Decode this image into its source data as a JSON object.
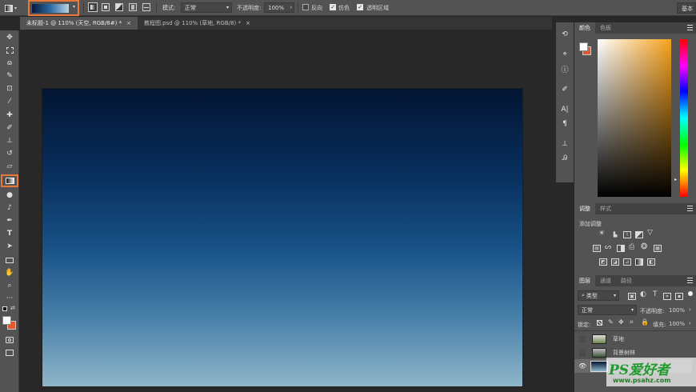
{
  "options_bar": {
    "mode_label": "模式:",
    "mode_value": "正常",
    "opacity_label": "不透明度:",
    "opacity_value": "100%",
    "reverse_label": "反向",
    "reverse_checked": false,
    "dither_label": "仿色",
    "dither_checked": true,
    "transparency_label": "透明区域",
    "transparency_checked": true,
    "workspace_label": "基本"
  },
  "tabs": [
    {
      "label": "未标题-1 @ 110% (天空, RGB/8#) *",
      "close": "×",
      "active": true
    },
    {
      "label": "教程图.psd @ 110% (草地, RGB/8) *",
      "close": "×",
      "active": false
    }
  ],
  "color_panel": {
    "tabs": [
      "颜色",
      "色板"
    ]
  },
  "adjust_panel": {
    "tabs": [
      "调整",
      "样式"
    ],
    "add_label": "添加调整"
  },
  "layers_panel": {
    "tabs": [
      "图层",
      "通道",
      "路径"
    ],
    "filter_label": "类型",
    "blend_mode": "正常",
    "opacity_label": "不透明度:",
    "opacity_value": "100%",
    "lock_label": "锁定:",
    "fill_label": "填充:",
    "fill_value": "100%",
    "layers": [
      {
        "name": "草地",
        "visible": false
      },
      {
        "name": "背景树林",
        "visible": false
      },
      {
        "name": "",
        "visible": true
      }
    ]
  },
  "watermark": {
    "logo": "PS爱好者",
    "url": "www.psahz.com"
  },
  "colors": {
    "ui_bg": "#535353",
    "canvas_top": "#031533",
    "canvas_bottom": "#8fb6c9",
    "highlight_orange": "#e8793a",
    "background_swatch": "#e25a2e"
  }
}
